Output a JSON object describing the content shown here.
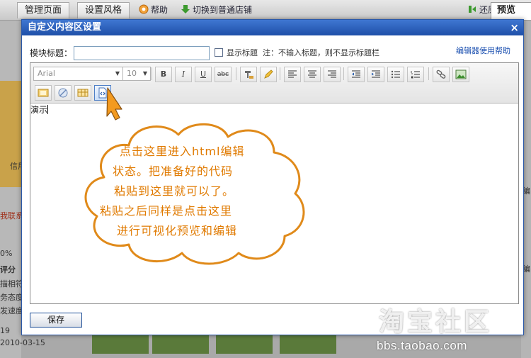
{
  "background": {
    "tabs": [
      "管理页面",
      "设置风格"
    ],
    "links": {
      "help": "帮助",
      "switch": "切换到普通店铺",
      "restore": "还原"
    },
    "preview_tab": "预览",
    "side_texts": [
      "信用",
      "0%",
      "评分",
      "描相符：",
      "务态度：",
      "发速度：",
      "19",
      "2010-03-15"
    ],
    "side_red": "我联系",
    "right_texts": [
      "编",
      "编"
    ],
    "watermark_logo": "淘宝社区",
    "watermark_url": "bbs.taobao.com"
  },
  "dialog": {
    "title": "自定义内容区设置",
    "close_label": "×",
    "module_title_label": "模块标题：",
    "module_title_value": "",
    "show_title_label": "显示标题",
    "show_title_note": "注：不输入标题，则不显示标题栏",
    "show_title_checked": false,
    "editor_help": "编辑器使用帮助",
    "toolbar": {
      "font_family": "Arial",
      "font_size": "10",
      "bold": "B",
      "italic": "I",
      "underline": "U",
      "strike": "abc"
    },
    "content_text": "演示",
    "save_label": "保存"
  },
  "callout": {
    "lines": [
      "点击这里进入html编辑",
      "状态。把准备好的代码",
      "粘贴到这里就可以了。",
      "粘贴之后同样是点击这里",
      "进行可视化预览和编辑"
    ],
    "color": "#e07a00"
  }
}
